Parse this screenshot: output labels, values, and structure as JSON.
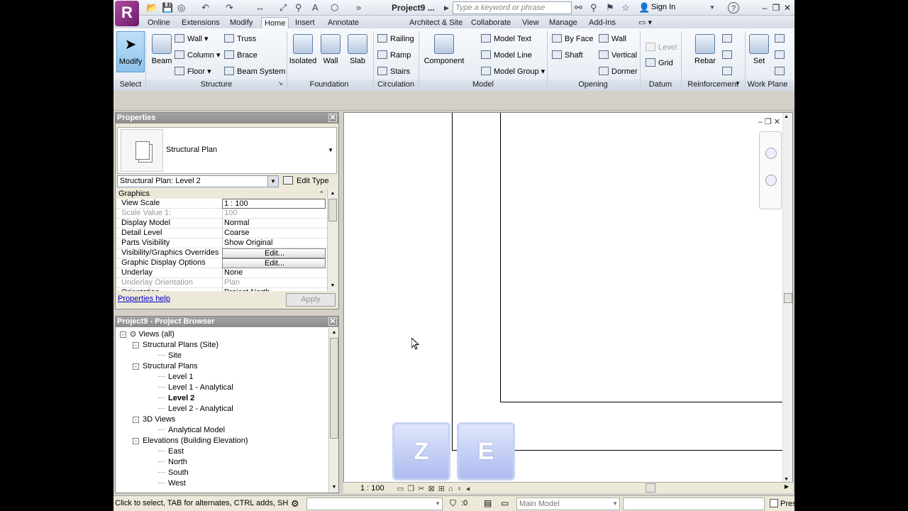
{
  "titlebar": {
    "doc_title": "Project9 ...",
    "search_placeholder": "Type a keyword or phrase",
    "sign_in": "Sign In",
    "help": "?"
  },
  "tabs": [
    "Online",
    "Extensions",
    "Modify",
    "Home",
    "Insert",
    "Annotate",
    "Architect & Site",
    "Collaborate",
    "View",
    "Manage",
    "Add-Ins"
  ],
  "active_tab": "Home",
  "ribbon": {
    "select": {
      "modify": "Modify",
      "label": "Select"
    },
    "structure": {
      "beam": "Beam",
      "wall": "Wall",
      "column": "Column",
      "floor": "Floor",
      "truss": "Truss",
      "brace": "Brace",
      "beam_system": "Beam System",
      "label": "Structure"
    },
    "foundation": {
      "isolated": "Isolated",
      "wall": "Wall",
      "slab": "Slab",
      "label": "Foundation"
    },
    "circulation": {
      "railing": "Railing",
      "ramp": "Ramp",
      "stairs": "Stairs",
      "label": "Circulation"
    },
    "model": {
      "component": "Component",
      "model_text": "Model Text",
      "model_line": "Model Line",
      "model_group": "Model Group",
      "label": "Model"
    },
    "opening": {
      "by_face": "By Face",
      "shaft": "Shaft",
      "wall": "Wall",
      "vertical": "Vertical",
      "dormer": "Dormer",
      "label": "Opening"
    },
    "datum": {
      "level": "Level",
      "grid": "Grid",
      "label": "Datum"
    },
    "reinforcement": {
      "rebar": "Rebar",
      "label": "Reinforcement"
    },
    "workplane": {
      "set": "Set",
      "label": "Work Plane"
    }
  },
  "properties": {
    "title": "Properties",
    "type_name": "Structural Plan",
    "instance": "Structural Plan: Level 2",
    "edit_type": "Edit Type",
    "group": "Graphics",
    "rows": [
      {
        "name": "View Scale",
        "value": "1 : 100",
        "style": "boxed"
      },
      {
        "name": "Scale Value    1:",
        "value": "100",
        "style": "dis"
      },
      {
        "name": "Display Model",
        "value": "Normal",
        "style": ""
      },
      {
        "name": "Detail Level",
        "value": "Coarse",
        "style": ""
      },
      {
        "name": "Parts Visibility",
        "value": "Show Original",
        "style": ""
      },
      {
        "name": "Visibility/Graphics Overrides",
        "value": "Edit...",
        "style": "btn"
      },
      {
        "name": "Graphic Display Options",
        "value": "Edit...",
        "style": "btn"
      },
      {
        "name": "Underlay",
        "value": "None",
        "style": ""
      },
      {
        "name": "Underlay Orientation",
        "value": "Plan",
        "style": "dis"
      },
      {
        "name": "Orientation",
        "value": "Project North",
        "style": ""
      }
    ],
    "help": "Properties help",
    "apply": "Apply"
  },
  "browser": {
    "title": "Project9 - Project Browser",
    "nodes": [
      {
        "label": "Views (all)",
        "level": 0,
        "toggle": "-",
        "bold": false
      },
      {
        "label": "Structural Plans (Site)",
        "level": 1,
        "toggle": "-",
        "bold": false
      },
      {
        "label": "Site",
        "level": 2,
        "toggle": "",
        "bold": false
      },
      {
        "label": "Structural Plans",
        "level": 1,
        "toggle": "-",
        "bold": false
      },
      {
        "label": "Level 1",
        "level": 2,
        "toggle": "",
        "bold": false
      },
      {
        "label": "Level 1 - Analytical",
        "level": 2,
        "toggle": "",
        "bold": false
      },
      {
        "label": "Level 2",
        "level": 2,
        "toggle": "",
        "bold": true
      },
      {
        "label": "Level 2 - Analytical",
        "level": 2,
        "toggle": "",
        "bold": false
      },
      {
        "label": "3D Views",
        "level": 1,
        "toggle": "-",
        "bold": false
      },
      {
        "label": "Analytical Model",
        "level": 2,
        "toggle": "",
        "bold": false
      },
      {
        "label": "Elevations (Building Elevation)",
        "level": 1,
        "toggle": "-",
        "bold": false
      },
      {
        "label": "East",
        "level": 2,
        "toggle": "",
        "bold": false
      },
      {
        "label": "North",
        "level": 2,
        "toggle": "",
        "bold": false
      },
      {
        "label": "South",
        "level": 2,
        "toggle": "",
        "bold": false
      },
      {
        "label": "West",
        "level": 2,
        "toggle": "",
        "bold": false
      }
    ]
  },
  "canvas": {
    "keys": [
      "Z",
      "E"
    ],
    "scale": "1 : 100"
  },
  "status": {
    "hint": "Click to select, TAB for alternates, CTRL adds, SHIFT unselects.",
    "coord": ":0",
    "model": "Main Model",
    "press_drag": "Press & Drag"
  }
}
